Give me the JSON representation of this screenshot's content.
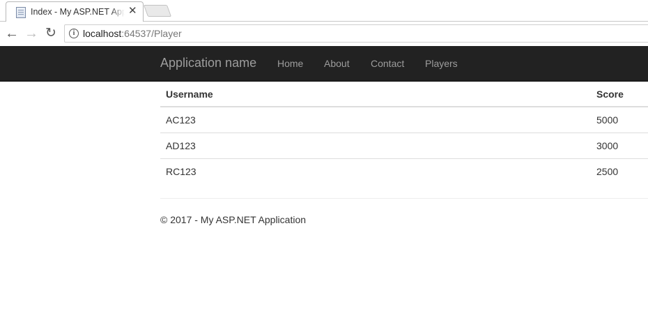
{
  "browser": {
    "tab_title": "Index - My ASP.NET Application",
    "url_host": "localhost",
    "url_rest": ":64537/Player",
    "icons": [
      "page-favicon-icon",
      "close-icon",
      "back-arrow-icon",
      "forward-arrow-icon",
      "reload-icon",
      "info-icon"
    ]
  },
  "navbar": {
    "brand": "Application name",
    "links": [
      "Home",
      "About",
      "Contact",
      "Players"
    ],
    "background": "#222222",
    "link_color": "#9d9d9d"
  },
  "table": {
    "headers": [
      "Username",
      "Score"
    ],
    "rows": [
      [
        "AC123",
        "5000"
      ],
      [
        "AD123",
        "3000"
      ],
      [
        "RC123",
        "2500"
      ]
    ]
  },
  "footer": {
    "text": "© 2017 - My ASP.NET Application"
  }
}
